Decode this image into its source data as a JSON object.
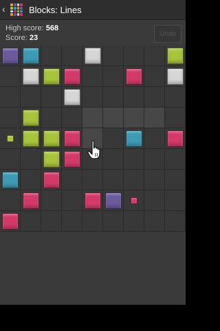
{
  "app": {
    "title": "Blocks: Lines",
    "back_glyph": "‹"
  },
  "icons": {
    "back": "chevron-left-icon",
    "app": "color-grid-icon",
    "pointer": "hand-pointer-icon"
  },
  "stats": {
    "high_score_label": "High score:",
    "high_score": "568",
    "score_label": "Score:",
    "score": "23"
  },
  "undo": {
    "label": "Undo",
    "enabled": false
  },
  "colors": {
    "purple": "#6b5a9e",
    "teal": "#3d9bb5",
    "silver": "#d6d6d6",
    "lime": "#a8c43a",
    "pink": "#d33a6a"
  },
  "board": {
    "columns": 9,
    "rows": 9,
    "highlighted_cells": [
      [
        3,
        4
      ],
      [
        3,
        5
      ],
      [
        3,
        6
      ],
      [
        3,
        7
      ],
      [
        4,
        4
      ]
    ],
    "blocks": [
      {
        "row": 0,
        "col": 0,
        "color": "purple",
        "size": "large"
      },
      {
        "row": 0,
        "col": 1,
        "color": "teal",
        "size": "large"
      },
      {
        "row": 0,
        "col": 4,
        "color": "silver",
        "size": "large"
      },
      {
        "row": 0,
        "col": 8,
        "color": "lime",
        "size": "large"
      },
      {
        "row": 1,
        "col": 1,
        "color": "silver",
        "size": "large"
      },
      {
        "row": 1,
        "col": 2,
        "color": "lime",
        "size": "large"
      },
      {
        "row": 1,
        "col": 3,
        "color": "pink",
        "size": "large"
      },
      {
        "row": 1,
        "col": 6,
        "color": "pink",
        "size": "large"
      },
      {
        "row": 1,
        "col": 8,
        "color": "silver",
        "size": "large"
      },
      {
        "row": 2,
        "col": 3,
        "color": "silver",
        "size": "large"
      },
      {
        "row": 3,
        "col": 1,
        "color": "lime",
        "size": "large"
      },
      {
        "row": 4,
        "col": 0,
        "color": "lime",
        "size": "small"
      },
      {
        "row": 4,
        "col": 1,
        "color": "lime",
        "size": "large"
      },
      {
        "row": 4,
        "col": 2,
        "color": "lime",
        "size": "large"
      },
      {
        "row": 4,
        "col": 3,
        "color": "pink",
        "size": "large"
      },
      {
        "row": 4,
        "col": 6,
        "color": "teal",
        "size": "large"
      },
      {
        "row": 4,
        "col": 8,
        "color": "pink",
        "size": "large"
      },
      {
        "row": 5,
        "col": 2,
        "color": "lime",
        "size": "large"
      },
      {
        "row": 5,
        "col": 3,
        "color": "pink",
        "size": "large"
      },
      {
        "row": 6,
        "col": 0,
        "color": "teal",
        "size": "large"
      },
      {
        "row": 6,
        "col": 2,
        "color": "pink",
        "size": "large"
      },
      {
        "row": 7,
        "col": 1,
        "color": "pink",
        "size": "large"
      },
      {
        "row": 7,
        "col": 4,
        "color": "pink",
        "size": "large"
      },
      {
        "row": 7,
        "col": 5,
        "color": "purple",
        "size": "large"
      },
      {
        "row": 7,
        "col": 6,
        "color": "pink",
        "size": "small"
      },
      {
        "row": 8,
        "col": 0,
        "color": "pink",
        "size": "large"
      }
    ]
  }
}
